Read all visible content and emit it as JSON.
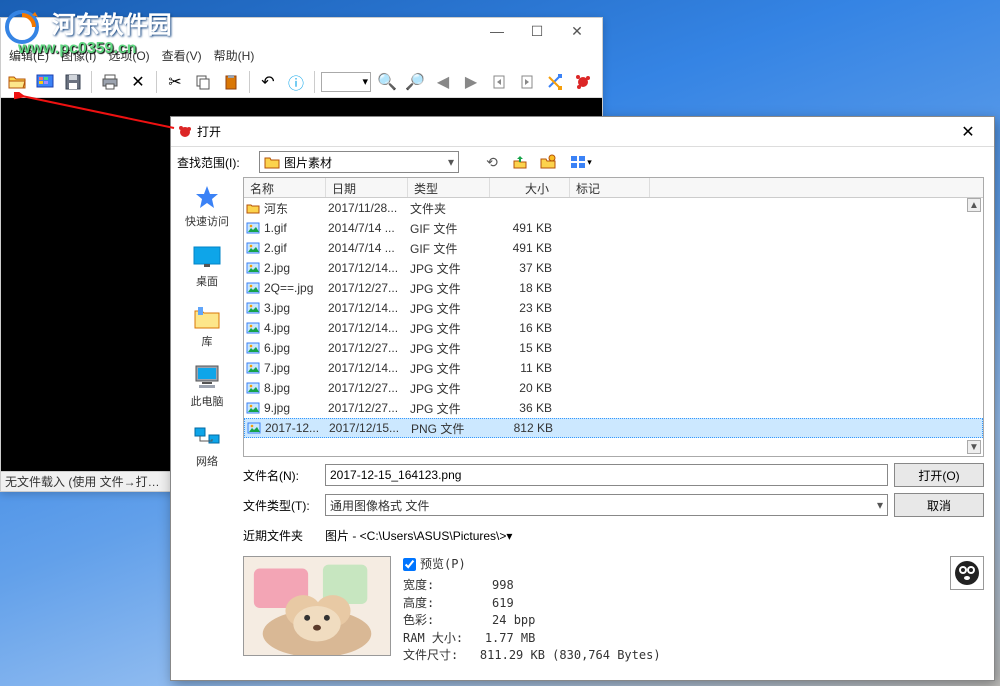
{
  "watermark": {
    "text": "河东软件园",
    "url": "www.pc0359.cn"
  },
  "main_window": {
    "menu": {
      "edit": "编辑(E)",
      "image": "图像(I)",
      "options": "选项(O)",
      "view": "查看(V)",
      "help": "帮助(H)"
    },
    "status": "无文件载入 (使用 文件→打…"
  },
  "dialog": {
    "title": "打开",
    "lookin_label": "查找范围(I):",
    "folder_name": "图片素材",
    "places": {
      "quick": "快速访问",
      "desktop": "桌面",
      "library": "库",
      "thispc": "此电脑",
      "network": "网络"
    },
    "columns": {
      "name": "名称",
      "date": "日期",
      "type": "类型",
      "size": "大小",
      "tag": "标记"
    },
    "files": [
      {
        "icon": "folder",
        "name": "河东",
        "date": "2017/11/28...",
        "type": "文件夹",
        "size": ""
      },
      {
        "icon": "image",
        "name": "1.gif",
        "date": "2014/7/14 ...",
        "type": "GIF 文件",
        "size": "491 KB"
      },
      {
        "icon": "image",
        "name": "2.gif",
        "date": "2014/7/14 ...",
        "type": "GIF 文件",
        "size": "491 KB"
      },
      {
        "icon": "image",
        "name": "2.jpg",
        "date": "2017/12/14...",
        "type": "JPG 文件",
        "size": "37 KB"
      },
      {
        "icon": "image",
        "name": "2Q==.jpg",
        "date": "2017/12/27...",
        "type": "JPG 文件",
        "size": "18 KB"
      },
      {
        "icon": "image",
        "name": "3.jpg",
        "date": "2017/12/14...",
        "type": "JPG 文件",
        "size": "23 KB"
      },
      {
        "icon": "image",
        "name": "4.jpg",
        "date": "2017/12/14...",
        "type": "JPG 文件",
        "size": "16 KB"
      },
      {
        "icon": "image",
        "name": "6.jpg",
        "date": "2017/12/27...",
        "type": "JPG 文件",
        "size": "15 KB"
      },
      {
        "icon": "image",
        "name": "7.jpg",
        "date": "2017/12/14...",
        "type": "JPG 文件",
        "size": "11 KB"
      },
      {
        "icon": "image",
        "name": "8.jpg",
        "date": "2017/12/27...",
        "type": "JPG 文件",
        "size": "20 KB"
      },
      {
        "icon": "image",
        "name": "9.jpg",
        "date": "2017/12/27...",
        "type": "JPG 文件",
        "size": "36 KB"
      },
      {
        "icon": "image",
        "name": "2017-12...",
        "date": "2017/12/15...",
        "type": "PNG 文件",
        "size": "812 KB",
        "selected": true
      }
    ],
    "filename_label": "文件名(N):",
    "filename_value": "2017-12-15_164123.png",
    "filetype_label": "文件类型(T):",
    "filetype_value": "通用图像格式 文件",
    "open_btn": "打开(O)",
    "cancel_btn": "取消",
    "recent_label": "近期文件夹",
    "recent_value": "图片 - <C:\\Users\\ASUS\\Pictures\\>",
    "preview": {
      "checkbox_label": "预览(P)",
      "width_label": "宽度:",
      "width_value": "998",
      "height_label": "高度:",
      "height_value": "619",
      "color_label": "色彩:",
      "color_value": "24 bpp",
      "ram_label": "RAM 大小:",
      "ram_value": "1.77 MB",
      "filesize_label": "文件尺寸:",
      "filesize_value": "811.29 KB (830,764 Bytes)"
    }
  }
}
